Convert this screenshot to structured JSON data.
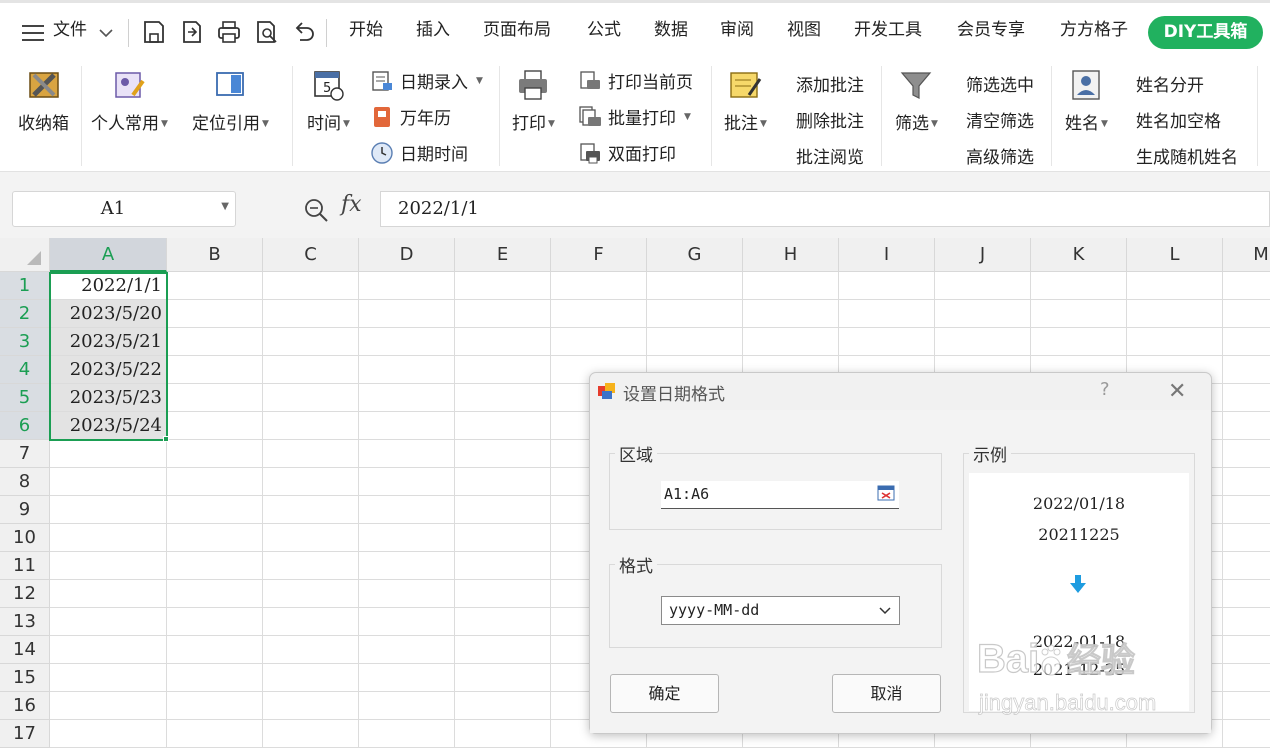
{
  "menubar": {
    "file_label": "文件",
    "tabs": [
      "开始",
      "插入",
      "页面布局",
      "公式",
      "数据",
      "审阅",
      "视图",
      "开发工具",
      "会员专享",
      "方方格子",
      "DIY工具箱"
    ],
    "accent_color": "#21b15f"
  },
  "ribbon": {
    "storage_box": "收纳箱",
    "personal_common": "个人常用",
    "locate_ref": "定位引用",
    "time": "时间",
    "date_entry": "日期录入",
    "perpetual_calendar": "万年历",
    "date_time": "日期时间",
    "print": "打印",
    "print_current_page": "打印当前页",
    "batch_print": "批量打印",
    "duplex_print": "双面打印",
    "comment": "批注",
    "add_comment": "添加批注",
    "delete_comment": "删除批注",
    "view_comment": "批注阅览",
    "filter": "筛选",
    "filter_selected": "筛选选中",
    "clear_filter": "清空筛选",
    "advanced_filter": "高级筛选",
    "name": "姓名",
    "split_name": "姓名分开",
    "name_add_space": "姓名加空格",
    "random_name": "生成随机姓名"
  },
  "formula_bar": {
    "cell_ref": "A1",
    "fx": "fx",
    "value": "2022/1/1"
  },
  "sheet": {
    "columns": [
      "A",
      "B",
      "C",
      "D",
      "E",
      "F",
      "G",
      "H",
      "I",
      "J",
      "K",
      "L",
      "M"
    ],
    "rows": [
      "1",
      "2",
      "3",
      "4",
      "5",
      "6",
      "7",
      "8",
      "9",
      "10",
      "11",
      "12",
      "13",
      "14",
      "15",
      "16",
      "17"
    ],
    "column_a_values": [
      "2022/1/1",
      "2023/5/20",
      "2023/5/21",
      "2023/5/22",
      "2023/5/23",
      "2023/5/24"
    ],
    "selection_color": "#1b9e53"
  },
  "dialog": {
    "title": "设置日期格式",
    "help": "?",
    "close": "✕",
    "range_label": "区域",
    "range_value": "A1:A6",
    "format_label": "格式",
    "format_value": "yyyy-MM-dd",
    "ok": "确定",
    "cancel": "取消",
    "example_label": "示例",
    "example_before": [
      "2022/01/18",
      "20211225"
    ],
    "example_after": [
      "2022-01-18",
      "2021-12-25"
    ]
  },
  "watermark": {
    "brand": "Bai",
    "brand_cn": "经验",
    "url": "jingyan.baidu.com"
  }
}
